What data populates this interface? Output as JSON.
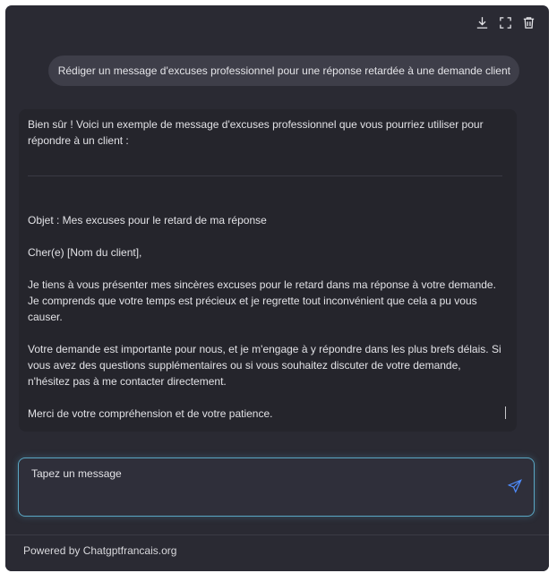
{
  "toolbar": {
    "icons": [
      "download-icon",
      "fullscreen-icon",
      "trash-icon"
    ]
  },
  "conversation": {
    "user_message": "Rédiger un message d'excuses professionnel pour une réponse retardée à une demande client",
    "assistant": {
      "intro": "Bien sûr ! Voici un exemple de message d'excuses professionnel que vous pourriez utiliser pour répondre à un client :",
      "subject": "Objet : Mes excuses pour le retard de ma réponse",
      "greeting": "Cher(e) [Nom du client],",
      "paragraph1": "Je tiens à vous présenter mes sincères excuses pour le retard dans ma réponse à votre demande. Je comprends que votre temps est précieux et je regrette tout inconvénient que cela a pu vous causer.",
      "paragraph2": "Votre demande est importante pour nous, et je m'engage à y répondre dans les plus brefs délais. Si vous avez des questions supplémentaires ou si vous souhaitez discuter de votre demande, n'hésitez pas à me contacter directement.",
      "closing": "Merci de votre compréhension et de votre patience."
    }
  },
  "input": {
    "placeholder": "Tapez un message",
    "value": ""
  },
  "footer": {
    "text": "Powered by Chatgptfrancais.org"
  },
  "colors": {
    "window_bg": "#2a2a33",
    "bubble_bg": "#3e3e49",
    "card_bg": "#25252c",
    "input_border": "#5aa7c4",
    "send_accent": "#4f8dff"
  }
}
